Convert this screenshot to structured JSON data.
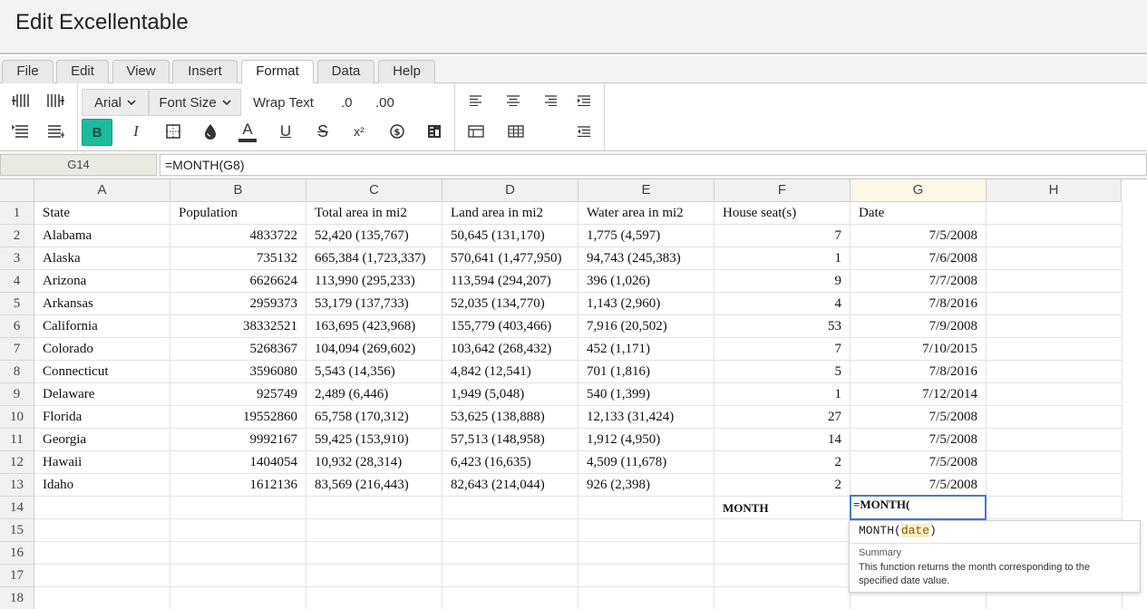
{
  "app": {
    "title": "Edit Excellentable"
  },
  "menu_tabs": [
    {
      "label": "File"
    },
    {
      "label": "Edit"
    },
    {
      "label": "View"
    },
    {
      "label": "Insert"
    },
    {
      "label": "Format",
      "active": true
    },
    {
      "label": "Data"
    },
    {
      "label": "Help"
    }
  ],
  "toolbar": {
    "font_family": "Arial",
    "font_size": "Font Size",
    "wrap_text": "Wrap Text",
    "decrease_decimal": ".0",
    "increase_decimal": ".00",
    "bold_label": "B",
    "italic_label": "I",
    "text_color_label": "A",
    "underline_label": "U",
    "strike_label": "S",
    "superscript_label": "x²",
    "accent_color": "#1abc9c"
  },
  "formula_bar": {
    "cell_ref": "G14",
    "formula": "=MONTH(G8)"
  },
  "columns": [
    "A",
    "B",
    "C",
    "D",
    "E",
    "F",
    "G",
    "H"
  ],
  "rows": [
    [
      "State",
      "Population",
      "Total area in mi2",
      "Land area in mi2",
      "Water area in mi2",
      "House seat(s)",
      "Date",
      ""
    ],
    [
      "Alabama",
      "4833722",
      "52,420 (135,767)",
      "50,645 (131,170)",
      "1,775 (4,597)",
      "7",
      "7/5/2008",
      ""
    ],
    [
      "Alaska",
      "735132",
      "665,384 (1,723,337)",
      "570,641 (1,477,950)",
      "94,743 (245,383)",
      "1",
      "7/6/2008",
      ""
    ],
    [
      "Arizona",
      "6626624",
      "113,990 (295,233)",
      "113,594 (294,207)",
      "396 (1,026)",
      "9",
      "7/7/2008",
      ""
    ],
    [
      "Arkansas",
      "2959373",
      "53,179 (137,733)",
      "52,035 (134,770)",
      "1,143 (2,960)",
      "4",
      "7/8/2016",
      ""
    ],
    [
      "California",
      "38332521",
      "163,695 (423,968)",
      "155,779 (403,466)",
      "7,916 (20,502)",
      "53",
      "7/9/2008",
      ""
    ],
    [
      "Colorado",
      "5268367",
      "104,094 (269,602)",
      "103,642 (268,432)",
      "452 (1,171)",
      "7",
      "7/10/2015",
      ""
    ],
    [
      "Connecticut",
      "3596080",
      "5,543 (14,356)",
      "4,842 (12,541)",
      "701 (1,816)",
      "5",
      "7/8/2016",
      ""
    ],
    [
      "Delaware",
      "925749",
      "2,489 (6,446)",
      "1,949 (5,048)",
      "540 (1,399)",
      "1",
      "7/12/2014",
      ""
    ],
    [
      "Florida",
      "19552860",
      "65,758 (170,312)",
      "53,625 (138,888)",
      "12,133 (31,424)",
      "27",
      "7/5/2008",
      ""
    ],
    [
      "Georgia",
      "9992167",
      "59,425 (153,910)",
      "57,513 (148,958)",
      "1,912 (4,950)",
      "14",
      "7/5/2008",
      ""
    ],
    [
      "Hawaii",
      "1404054",
      "10,932 (28,314)",
      "6,423 (16,635)",
      "4,509 (11,678)",
      "2",
      "7/5/2008",
      ""
    ],
    [
      "Idaho",
      "1612136",
      "83,569 (216,443)",
      "82,643 (214,044)",
      "926 (2,398)",
      "2",
      "7/5/2008",
      ""
    ],
    [
      "",
      "",
      "",
      "",
      "",
      "MONTH",
      "",
      ""
    ],
    [
      "",
      "",
      "",
      "",
      "",
      "",
      "",
      ""
    ],
    [
      "",
      "",
      "",
      "",
      "",
      "",
      "",
      ""
    ],
    [
      "",
      "",
      "",
      "",
      "",
      "",
      "",
      ""
    ],
    [
      "",
      "",
      "",
      "",
      "",
      "",
      "",
      ""
    ]
  ],
  "row_numbers": [
    "1",
    "2",
    "3",
    "4",
    "5",
    "6",
    "7",
    "8",
    "9",
    "10",
    "11",
    "12",
    "13",
    "14",
    "15",
    "16",
    "17",
    "18"
  ],
  "selected_column": "G",
  "editor": {
    "value": "=MONTH(",
    "hint_fn": "MONTH(",
    "hint_arg": "date",
    "hint_close": ")",
    "summary_label": "Summary",
    "summary_text": "This function returns the month corresponding to the specified date value."
  }
}
